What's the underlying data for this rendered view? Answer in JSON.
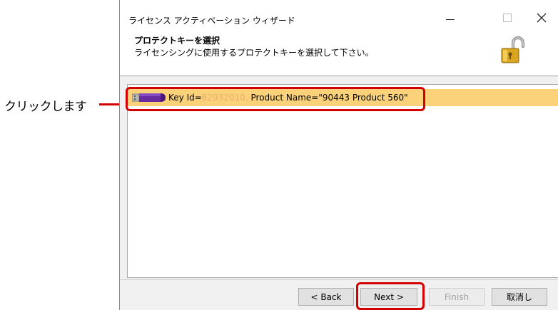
{
  "annotation": {
    "callout_label": "クリックします",
    "highlight_color": "#d40000"
  },
  "window": {
    "title": "ライセンス アクティベーション ウィザード",
    "controls": {
      "minimize": "minimize-icon",
      "maximize": "maximize-icon",
      "close": "close-icon"
    }
  },
  "header": {
    "title": "プロテクトキーを選択",
    "subtitle": "ライセンシングに使用するプロテクトキーを選択して下さい。",
    "icon": "padlock-open-icon"
  },
  "key_list": {
    "selected_color": "#fbd27a",
    "items": [
      {
        "icon": "usb-key-icon",
        "label_prefix": "Key Id=",
        "key_id": "62932010,",
        "label_suffix": " Product Name=\"90443 Product 560\""
      }
    ]
  },
  "buttons": {
    "back": "< Back",
    "next": "Next >",
    "finish": "Finish",
    "cancel": "取消し"
  }
}
